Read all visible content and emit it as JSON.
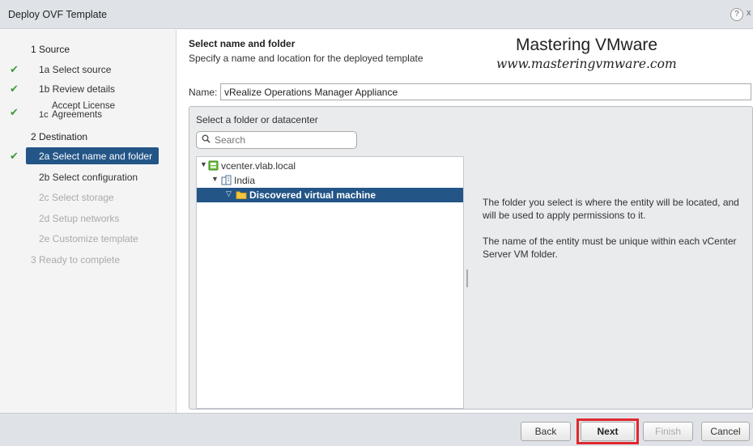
{
  "window": {
    "title": "Deploy OVF Template",
    "help": "?",
    "close": "x"
  },
  "sidebar": {
    "steps": [
      {
        "label": "1  Source",
        "kind": "group",
        "checked": false
      },
      {
        "label": "1a  Select source",
        "kind": "sub",
        "checked": true
      },
      {
        "label": "1b  Review details",
        "kind": "sub",
        "checked": true
      },
      {
        "label_prefix": "1c",
        "label_line1": "Accept License",
        "label_line2": "Agreements",
        "kind": "sub",
        "checked": true
      },
      {
        "label": "2  Destination",
        "kind": "group",
        "checked": false
      },
      {
        "label": "2a  Select name and folder",
        "kind": "active",
        "checked": true
      },
      {
        "label": "2b  Select configuration",
        "kind": "sub",
        "checked": false
      },
      {
        "label": "2c  Select storage",
        "kind": "disabled",
        "checked": false
      },
      {
        "label": "2d  Setup networks",
        "kind": "disabled",
        "checked": false
      },
      {
        "label": "2e  Customize template",
        "kind": "disabled",
        "checked": false
      },
      {
        "label": "3  Ready to complete",
        "kind": "disabled",
        "checked": false
      }
    ]
  },
  "header": {
    "title": "Select name and folder",
    "subtitle": "Specify a name and location for the deployed template"
  },
  "watermark": {
    "line1": "Mastering VMware",
    "line2": "www.masteringvmware.com"
  },
  "name_field": {
    "label": "Name:",
    "value": "vRealize Operations Manager Appliance"
  },
  "folder_panel": {
    "title": "Select a folder or datacenter",
    "search_placeholder": "Search",
    "tree": [
      {
        "label": "vcenter.vlab.local",
        "level": 0,
        "icon": "vcenter-icon",
        "selected": false
      },
      {
        "label": "India",
        "level": 1,
        "icon": "datacenter-icon",
        "selected": false
      },
      {
        "label": "Discovered virtual machine",
        "level": 2,
        "icon": "folder-icon",
        "selected": true
      }
    ],
    "info": [
      "The folder you select is where the entity will be located, and will be used to apply permissions to it.",
      "The name of the entity must be unique within each vCenter Server VM folder."
    ]
  },
  "footer": {
    "back": "Back",
    "next": "Next",
    "finish": "Finish",
    "cancel": "Cancel"
  },
  "colors": {
    "selection": "#235587",
    "check": "#3c9a3c",
    "next_highlight": "#e0282e"
  }
}
